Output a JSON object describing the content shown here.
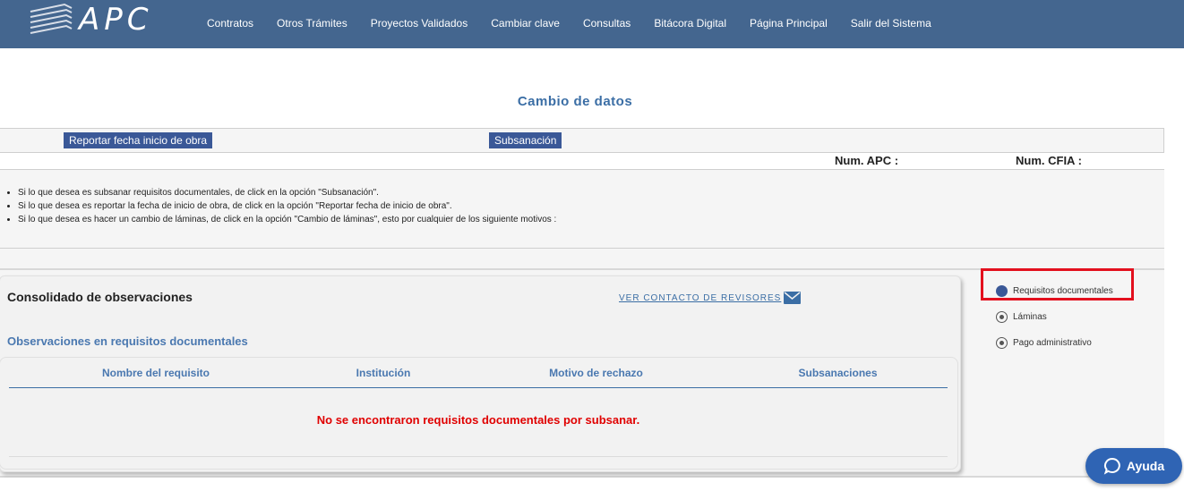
{
  "header": {
    "brand": "APC",
    "nav": [
      "Contratos",
      "Otros Trámites",
      "Proyectos Validados",
      "Cambiar clave",
      "Consultas",
      "Bitácora Digital",
      "Página Principal",
      "Salir del Sistema"
    ]
  },
  "page_title": "Cambio de datos",
  "actions": {
    "report_start": "Reportar fecha inicio de obra",
    "subsanacion": "Subsanación"
  },
  "nums": {
    "apc_label": "Num. APC :",
    "cfia_label": "Num. CFIA :"
  },
  "info": {
    "items": [
      "Si lo que desea es subsanar requisitos documentales, de click en la opción \"Subsanación\".",
      "Si lo que desea es reportar la fecha de inicio de obra, de click en la opción \"Reportar fecha de inicio de obra\".",
      "Si lo que desea es hacer un cambio de láminas, de click en la opción \"Cambio de láminas\", esto por cualquier de los siguiente motivos :"
    ]
  },
  "observations": {
    "title": "Consolidado de observaciones",
    "contact_link": "VER CONTACTO DE REVISORES",
    "subtitle": "Observaciones en requisitos documentales",
    "columns": [
      "Nombre del requisito",
      "Institución",
      "Motivo de rechazo",
      "Subsanaciones"
    ],
    "empty_message": "No se encontraron requisitos documentales por subsanar."
  },
  "radio_options": [
    {
      "label": "Requisitos documentales",
      "selected": true
    },
    {
      "label": "Láminas",
      "selected": false
    },
    {
      "label": "Pago administrativo",
      "selected": false
    }
  ],
  "help": {
    "label": "Ayuda"
  },
  "colors": {
    "header_bg": "#44668f",
    "accent_blue": "#3a5897",
    "error_red": "#e00000",
    "highlight_red": "#e3101e"
  }
}
